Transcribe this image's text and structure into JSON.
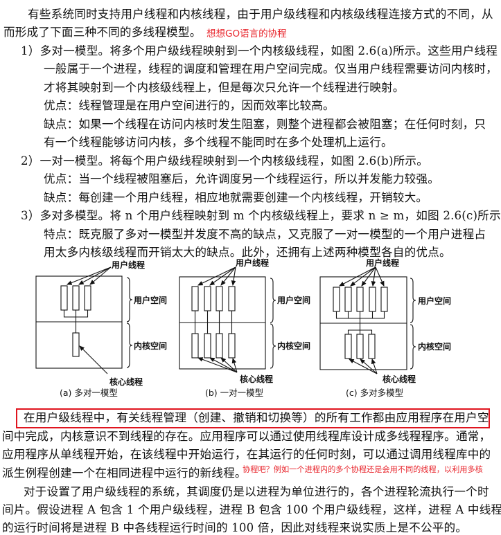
{
  "paragraph1": [
    "有些系统同时支持用户线程和内核线程，由于用户级线程和内核级线程连接方式的不同，从",
    "而形成了下面三种不同的多线程模型。"
  ],
  "note1": "想想GO语言的协程",
  "item1": [
    "1）多对一模型。将多个用户级线程映射到一个内核级线程，如图 2.6(a)所示。这些用户线程",
    "一般属于一个进程，线程的调度和管理在用户空间完成。仅当用户线程需要访问内核时，",
    "才将其映射到一个内核级线程上，但是每次只允许一个线程进行映射。",
    "优点：线程管理是在用户空间进行的，因而效率比较高。",
    "缺点：如果一个线程在访问内核时发生阻塞，则整个进程都会被阻塞；在任何时刻，只",
    "有一个线程能够访问内核，多个线程不能同时在多个处理机上运行。"
  ],
  "item2": [
    "2）一对一模型。将每个用户级线程映射到一个内核级线程，如图 2.6(b)所示。",
    "优点：当一个线程被阻塞后，允许调度另一个线程运行，所以并发能力较强。",
    "缺点：每创建一个用户线程，相应地就需要创建一个内核线程，开销较大。"
  ],
  "item3": [
    "3）多对多模型。将 n 个用户线程映射到 m 个内核级线程上，要求 n ≥ m，如图 2.6(c)所示。",
    "特点：既克服了多对一模型并发度不高的缺点，又克服了一对一模型的一个用户进程占",
    "用太多内核级线程而开销太大的缺点。此外，还拥有上述两种模型各自的优点。"
  ],
  "figure": {
    "user_threads_label": "用户线程",
    "kernel_threads_label": "核心线程",
    "user_space_label": "用户空间",
    "kernel_space_label": "内核空间",
    "captions": [
      "(a) 多对一模型",
      "(b) 一对一模型",
      "(c) 多对多模型"
    ]
  },
  "paragraph2": [
    "在用户级线程中，有关线程管理（创建、撤销和切换等）的所有工作都由应用程序在用户空",
    "间中完成，内核意识不到线程的存在。应用程序可以通过使用线程库设计成多线程程序。通常，",
    "应用程序从单线程开始，在该线程中开始运行，在其运行的任何时刻，可以通过调用线程库中的",
    "派生例程创建一个在相同进程中运行的新线程。"
  ],
  "note2": "协程吧？例如一个进程内的多个协程还是会用不同的线程，以利用多核",
  "paragraph3": [
    "对于设置了用户级线程的系统，其调度仍是以进程为单位进行的，各个进程轮流执行一个时",
    "间片。假设进程 A 包含 1 个用户级线程，进程 B 包含 100 个用户级线程，这样，进程 A 中线程",
    "的运行时间将是进程 B 中各线程运行时间的 100 倍，因此对线程来说实质上是不公平的。"
  ],
  "colors": {
    "annotation": "#e8242b",
    "highlight_box": "#e0141e"
  }
}
